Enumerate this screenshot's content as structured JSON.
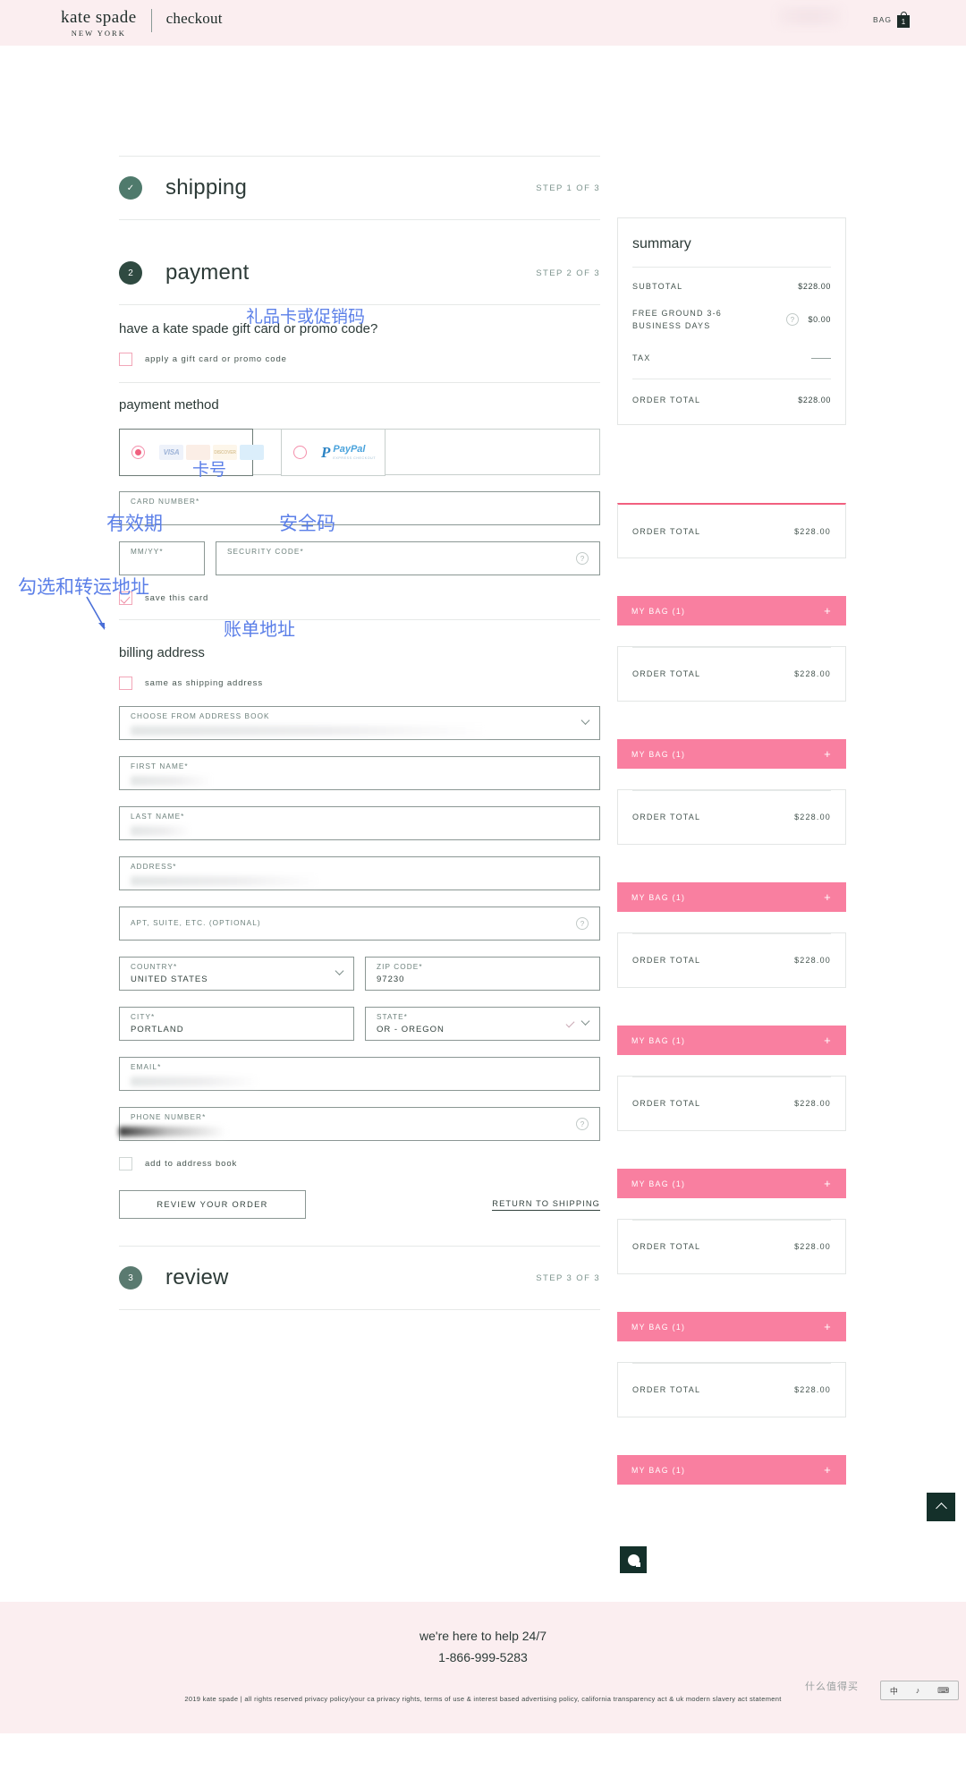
{
  "header": {
    "brand": "kate spade",
    "brand_sub": "NEW YORK",
    "page": "checkout",
    "bag_label": "BAG",
    "bag_count": "1"
  },
  "steps": {
    "shipping": {
      "title": "shipping",
      "count": "STEP 1 OF 3",
      "badge": "✓"
    },
    "payment": {
      "title": "payment",
      "count": "STEP 2 OF 3",
      "badge": "2"
    },
    "review": {
      "title": "review",
      "count": "STEP 3 OF 3",
      "badge": "3"
    }
  },
  "payment": {
    "gift_question": "have a kate spade gift card or promo code?",
    "gift_checkbox_label": "apply a gift card or promo code",
    "method_heading": "payment method",
    "card_logos": [
      "VISA",
      "mastercard",
      "DISCOVER",
      "AMEX"
    ],
    "paypal_name": "PayPal",
    "paypal_sub": "EXPRESS CHECKOUT",
    "card_number_label": "CARD NUMBER*",
    "expiry_label": "MM/YY*",
    "security_label": "SECURITY CODE*",
    "save_card_label": "save this card"
  },
  "billing": {
    "heading": "billing address",
    "same_as_shipping_label": "same as shipping address",
    "address_book_label": "CHOOSE FROM ADDRESS BOOK",
    "first_name_label": "FIRST NAME*",
    "last_name_label": "LAST NAME*",
    "address_label": "ADDRESS*",
    "apt_label": "APT, SUITE, ETC. (OPTIONAL)",
    "country_label": "COUNTRY*",
    "country_value": "UNITED STATES",
    "zip_label": "ZIP CODE*",
    "zip_value": "97230",
    "city_label": "CITY*",
    "city_value": "PORTLAND",
    "state_label": "STATE*",
    "state_value": "OR - OREGON",
    "email_label": "EMAIL*",
    "phone_label": "PHONE NUMBER*",
    "add_to_book_label": "add to address book",
    "review_button": "REVIEW YOUR ORDER",
    "return_link": "RETURN TO SHIPPING"
  },
  "summary": {
    "title": "summary",
    "subtotal_label": "SUBTOTAL",
    "subtotal_value": "$228.00",
    "shipping_label": "FREE GROUND 3-6 BUSINESS DAYS",
    "shipping_value": "$0.00",
    "tax_label": "TAX",
    "tax_value": "—",
    "order_total_label": "ORDER TOTAL",
    "order_total_value": "$228.00"
  },
  "repeat_panels": {
    "order_total_label": "ORDER TOTAL",
    "order_total_value": "$228.00",
    "mybag_label": "MY BAG (1)",
    "plus": "+"
  },
  "annotations": {
    "gift_code": "礼品卡或促销码",
    "card_number": "卡号",
    "expiry": "有效期",
    "security": "安全码",
    "check_forward_address": "勾选和转运地址",
    "billing_address": "账单地址"
  },
  "footer": {
    "help": "we're here to help 24/7",
    "phone": "1-866-999-5283",
    "legal": "2019 kate spade | all rights reserved privacy policy/your ca privacy rights, terms of use & interest based advertising policy, california transparency act & uk modern slavery act statement"
  },
  "ime": {
    "lang": "中",
    "mode": "♪",
    "kb": "⌨"
  },
  "watermark": {
    "text": "什么值得买"
  }
}
